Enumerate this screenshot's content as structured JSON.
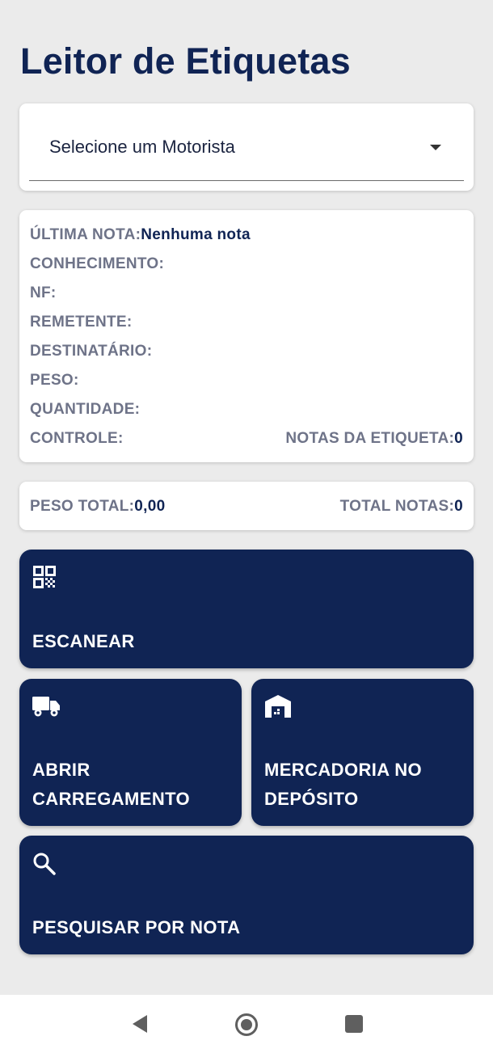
{
  "header": {
    "title": "Leitor de Etiquetas"
  },
  "driver_select": {
    "placeholder": "Selecione um Motorista"
  },
  "note_info": {
    "last_note_label": "ÚLTIMA NOTA:",
    "last_note_value": "Nenhuma nota",
    "conhecimento_label": "CONHECIMENTO:",
    "nf_label": "NF:",
    "remetente_label": "REMETENTE:",
    "destinatario_label": "DESTINATÁRIO:",
    "peso_label": "PESO:",
    "quantidade_label": "QUANTIDADE:",
    "controle_label": "CONTROLE:",
    "notas_etiqueta_label": "NOTAS DA ETIQUETA:",
    "notas_etiqueta_value": "0"
  },
  "totals": {
    "peso_total_label": "PESO TOTAL:",
    "peso_total_value": "0,00",
    "total_notas_label": "TOTAL NOTAS:",
    "total_notas_value": "0"
  },
  "actions": {
    "scan": {
      "label": "ESCANEAR",
      "icon": "qr-code-icon"
    },
    "open_loading": {
      "line1": "ABRIR",
      "line2": "CARREGAMENTO",
      "icon": "truck-icon"
    },
    "warehouse": {
      "line1": "MERCADORIA NO",
      "line2": "DEPÓSITO",
      "icon": "warehouse-icon"
    },
    "search": {
      "label": "PESQUISAR POR NOTA",
      "icon": "search-icon"
    }
  },
  "colors": {
    "primary": "#102454",
    "background": "#ebebeb",
    "label_gray": "#6e7388"
  }
}
